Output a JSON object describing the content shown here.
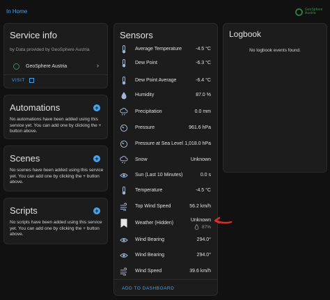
{
  "breadcrumb": "In Home",
  "logo": {
    "line1": "GeoSphere",
    "line2": "Austria"
  },
  "service": {
    "title": "Service info",
    "by": "by Data provided by GeoSphere Austria",
    "provider": "GeoSphere Austria",
    "visit": "VISIT"
  },
  "automations": {
    "title": "Automations",
    "text": "No automations have been added using this service yet. You can add one by clicking the + button above."
  },
  "scenes": {
    "title": "Scenes",
    "text": "No scenes have been added using this service yet. You can add one by clicking the + button above."
  },
  "scripts": {
    "title": "Scripts",
    "text": "No scripts have been added using this service yet. You can add one by clicking the + button above."
  },
  "sensors": {
    "title": "Sensors",
    "add_to_dashboard": "ADD TO DASHBOARD",
    "rows": [
      {
        "icon": "thermometer-icon",
        "name": "Average Temperature",
        "value": "-4.5 °C"
      },
      {
        "icon": "thermometer-icon",
        "name": "Dew Point",
        "value": "-6.3 °C"
      },
      {
        "icon": "thermometer-icon",
        "name": "Dew Point Average",
        "value": "-6.4 °C"
      },
      {
        "icon": "water-drop-icon",
        "name": "Humidity",
        "value": "87.0 %"
      },
      {
        "icon": "cloud-rain-icon",
        "name": "Precipitation",
        "value": "0.0 mm"
      },
      {
        "icon": "gauge-icon",
        "name": "Pressure",
        "value": "961.6 hPa"
      },
      {
        "icon": "gauge-icon",
        "name": "Pressure at Sea Level",
        "value": "1,018.0 hPa"
      },
      {
        "icon": "snow-cloud-icon",
        "name": "Snow",
        "value": "Unknown"
      },
      {
        "icon": "eye-icon",
        "name": "Sun (Last 10 Minutes)",
        "value": "0.0 s"
      },
      {
        "icon": "thermometer-icon",
        "name": "Temperature",
        "value": "-4.5 °C"
      },
      {
        "icon": "wind-icon",
        "name": "Top Wind Speed",
        "value": "56.2 km/h"
      },
      {
        "icon": "bookmark-icon",
        "name": "Weather (Hidden)",
        "value": "Unknown",
        "sub": "87%"
      },
      {
        "icon": "eye-icon",
        "name": "Wind Bearing",
        "value": "294.0°"
      },
      {
        "icon": "eye-icon",
        "name": "Wind Bearing",
        "value": "294.0°"
      },
      {
        "icon": "wind-icon",
        "name": "Wind Speed",
        "value": "39.6 km/h"
      }
    ]
  },
  "logbook": {
    "title": "Logbook",
    "empty": "No logbook events found."
  },
  "colors": {
    "accent": "#4aa3e8",
    "card": "#1c1c1c",
    "background": "#111111",
    "annotation_arrow": "#d9302b"
  }
}
